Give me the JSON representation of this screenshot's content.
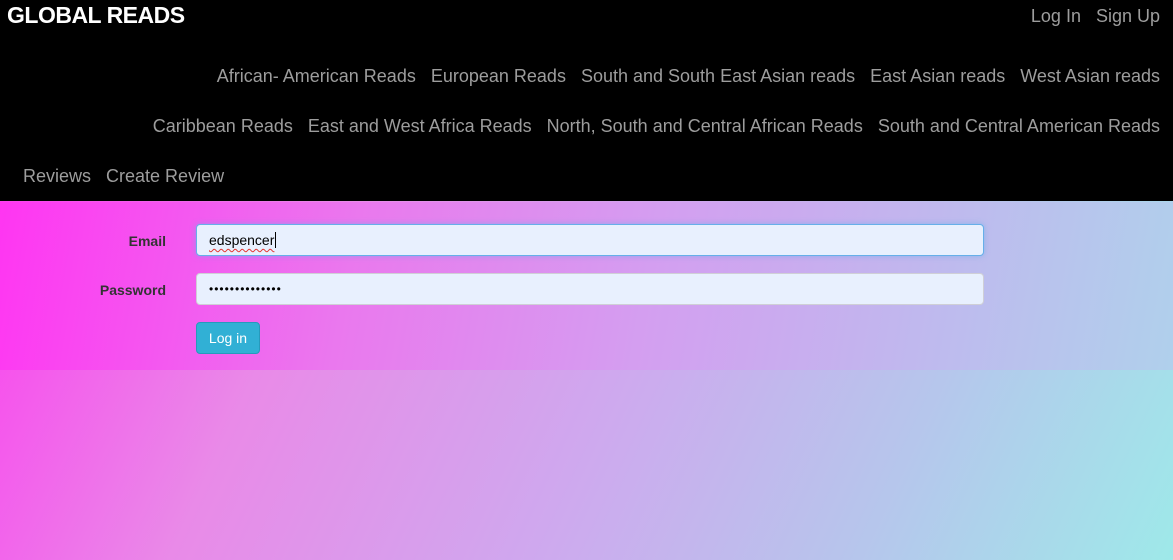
{
  "navbar": {
    "brand": "GLOBAL READS",
    "auth_links": [
      {
        "label": "Log In"
      },
      {
        "label": "Sign Up"
      }
    ],
    "row1": [
      {
        "label": "African- American Reads"
      },
      {
        "label": "European Reads"
      },
      {
        "label": "South and South East Asian reads"
      },
      {
        "label": "East Asian reads"
      },
      {
        "label": "West Asian reads"
      }
    ],
    "row2": [
      {
        "label": "Caribbean Reads"
      },
      {
        "label": "East and West Africa Reads"
      },
      {
        "label": "North, South and Central African Reads"
      },
      {
        "label": "South and Central American Reads"
      }
    ],
    "row3": [
      {
        "label": "Reviews"
      },
      {
        "label": "Create Review"
      }
    ]
  },
  "login_form": {
    "email_label": "Email",
    "email_value": "edspencer",
    "password_label": "Password",
    "password_value": "••••••••••••••",
    "submit_label": "Log in"
  },
  "colors": {
    "navbar_bg": "#000000",
    "nav_link": "#9d9d9d",
    "brand": "#ffffff",
    "button_bg": "#31b0d5",
    "gradient_start": "#ff2ef0",
    "gradient_end": "#9ee9e9"
  }
}
